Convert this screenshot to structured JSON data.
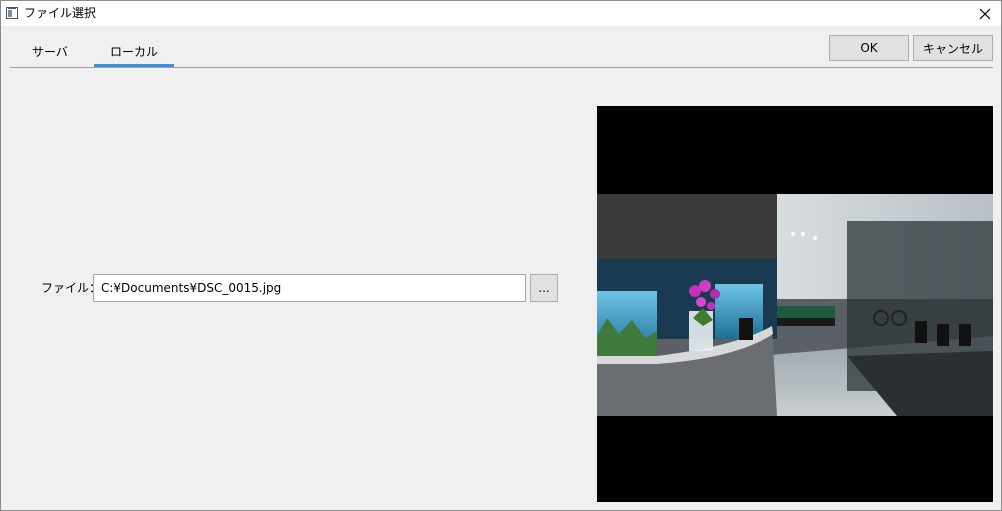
{
  "window": {
    "title": "ファイル選択"
  },
  "tabs": [
    {
      "label": "サーバ",
      "active": false
    },
    {
      "label": "ローカル",
      "active": true
    }
  ],
  "buttons": {
    "ok_label": "OK",
    "cancel_label": "キャンセル"
  },
  "file": {
    "label": "ファイル：",
    "value": "C:¥Documents¥DSC_0015.jpg",
    "browse_label": "..."
  },
  "preview": {
    "icon": "image-preview"
  },
  "colors": {
    "accent": "#3c8ee0",
    "background": "#f0f0f0",
    "button": "#e1e1e1"
  }
}
